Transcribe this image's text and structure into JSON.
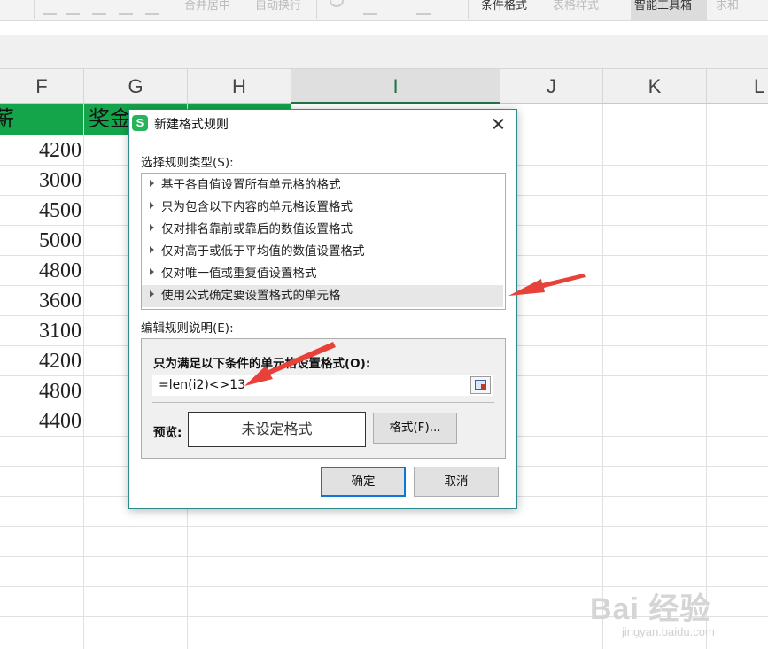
{
  "ribbon": {
    "items": [
      "合并居中",
      "自动换行",
      "条件格式",
      "表格样式",
      "智能工具箱",
      "求和"
    ]
  },
  "columns": [
    "F",
    "G",
    "H",
    "I",
    "J",
    "K",
    "L"
  ],
  "sheet": {
    "header_cells": [
      "薪",
      "奖金"
    ],
    "values": [
      "4200",
      "3000",
      "4500",
      "5000",
      "4800",
      "3600",
      "3100",
      "4200",
      "4800",
      "4400"
    ]
  },
  "dialog": {
    "app_icon": "S",
    "title": "新建格式规则",
    "rule_type_label": "选择规则类型(S):",
    "rule_types": [
      "基于各自值设置所有单元格的格式",
      "只为包含以下内容的单元格设置格式",
      "仅对排名靠前或靠后的数值设置格式",
      "仅对高于或低于平均值的数值设置格式",
      "仅对唯一值或重复值设置格式",
      "使用公式确定要设置格式的单元格"
    ],
    "selected_rule_index": 5,
    "edit_label": "编辑规则说明(E):",
    "condition_label": "只为满足以下条件的单元格设置格式(O):",
    "formula_value": "=len(i2)<>13",
    "preview_label": "预览:",
    "preview_text": "未设定格式",
    "format_button": "格式(F)...",
    "ok_button": "确定",
    "cancel_button": "取消"
  },
  "watermark": {
    "logo": "Bai 经验",
    "sub": "jingyan.baidu.com"
  },
  "colors": {
    "header_fill": "#14a44a",
    "accent": "#217346",
    "arrow": "#e8413a",
    "dialog_border": "#2b8a8e",
    "primary_button_border": "#0a78d7"
  }
}
